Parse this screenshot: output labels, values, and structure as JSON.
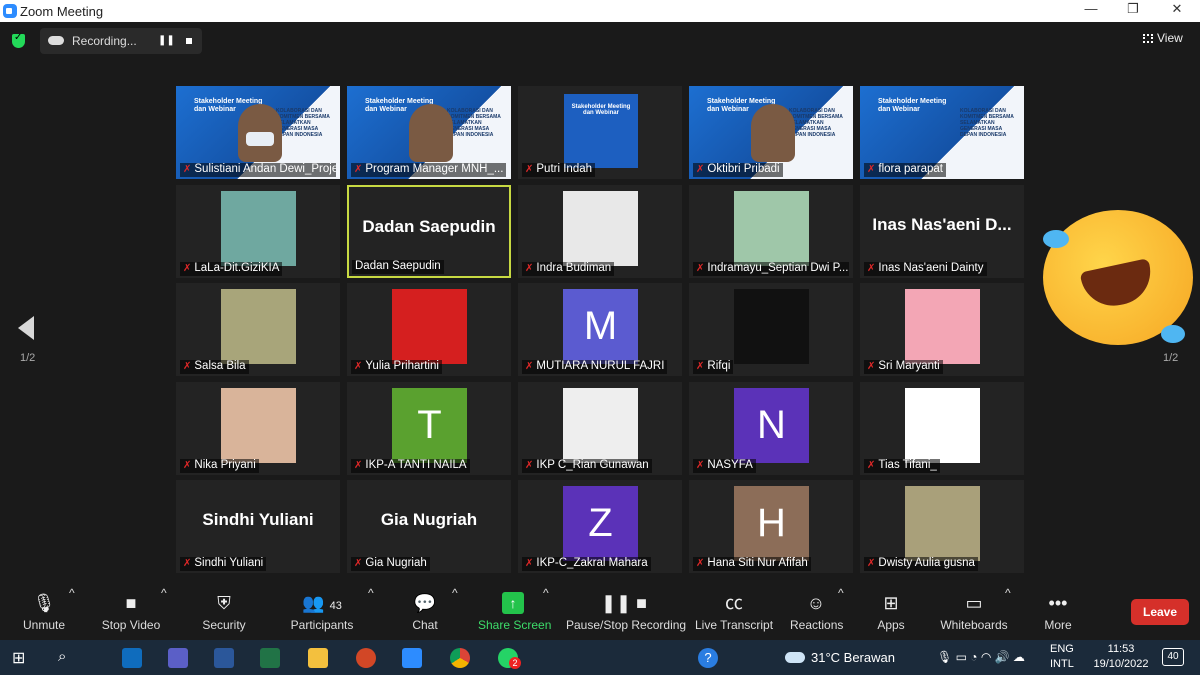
{
  "window": {
    "title": "Zoom Meeting",
    "minimize": "—",
    "maximize": "❐",
    "close": "✕"
  },
  "top": {
    "recording_label": "Recording...",
    "view_label": "View"
  },
  "pager": {
    "left": "1/2",
    "right": "1/2"
  },
  "tiles": [
    {
      "name": "Sulistiani Andan Dewi_Proje...",
      "muted": true,
      "kind": "video-slide"
    },
    {
      "name": "Program Manager MNH_...",
      "muted": true,
      "kind": "video-slide"
    },
    {
      "name": "Putri Indah",
      "muted": true,
      "kind": "slide-small"
    },
    {
      "name": "Oktibri Pribadi",
      "muted": true,
      "kind": "video-slide"
    },
    {
      "name": "flora parapat",
      "muted": true,
      "kind": "slide-only"
    },
    {
      "name": "LaLa-Dit.GiziKIA",
      "muted": true,
      "kind": "photo",
      "color": "#6fa8a0"
    },
    {
      "name": "Dadan Saepudin",
      "muted": false,
      "kind": "bigname",
      "big": "Dadan Saepudin",
      "active": true
    },
    {
      "name": "Indra Budiman",
      "muted": true,
      "kind": "photo",
      "color": "#e8e8e8"
    },
    {
      "name": "Indramayu_Septian Dwi P...",
      "muted": true,
      "kind": "photo",
      "color": "#9fc7a9"
    },
    {
      "name": "Inas Nas'aeni Dainty",
      "muted": true,
      "kind": "bigname",
      "big": "Inas  Nas'aeni  D..."
    },
    {
      "name": "Salsa Bila",
      "muted": true,
      "kind": "photo",
      "color": "#a8a57a"
    },
    {
      "name": "Yulia Prihartini",
      "muted": true,
      "kind": "photo",
      "color": "#d51f1f"
    },
    {
      "name": "MUTIARA NURUL FAJRI",
      "muted": true,
      "kind": "letter",
      "letter": "M",
      "color": "#5b5bd0"
    },
    {
      "name": "Rifqi",
      "muted": true,
      "kind": "photo",
      "color": "#111111"
    },
    {
      "name": "Sri Maryanti",
      "muted": true,
      "kind": "photo",
      "color": "#f3a6b5"
    },
    {
      "name": "Nika Priyani",
      "muted": true,
      "kind": "photo",
      "color": "#d9b49a"
    },
    {
      "name": "IKP-A TANTI NAILA",
      "muted": true,
      "kind": "letter",
      "letter": "T",
      "color": "#5aa12f"
    },
    {
      "name": "IKP C_Rian Gunawan",
      "muted": true,
      "kind": "photo",
      "color": "#eeeeee"
    },
    {
      "name": "NASYFA",
      "muted": true,
      "kind": "letter",
      "letter": "N",
      "color": "#5b32b8"
    },
    {
      "name": "Tias Tifani_",
      "muted": true,
      "kind": "photo",
      "color": "#ffffff"
    },
    {
      "name": "Sindhi Yuliani",
      "muted": true,
      "kind": "bigname",
      "big": "Sindhi Yuliani"
    },
    {
      "name": "Gia Nugriah",
      "muted": true,
      "kind": "bigname",
      "big": "Gia Nugriah"
    },
    {
      "name": "IKP-C_Zakral Mahara",
      "muted": true,
      "kind": "letter",
      "letter": "Z",
      "color": "#5b32b8"
    },
    {
      "name": "Hana Siti Nur Afifah",
      "muted": true,
      "kind": "letter",
      "letter": "H",
      "color": "#8c6d58"
    },
    {
      "name": "Dwisty Aulia gusna",
      "muted": true,
      "kind": "photo",
      "color": "#a9a07a"
    }
  ],
  "slide": {
    "title": "Stakeholder Meeting dan Webinar",
    "subtitle": "KOLABORASI DAN KOMITMEN BERSAMA SELAMATKAN GENERASI MASA DEPAN INDONESIA"
  },
  "toolbar": {
    "unmute": "Unmute",
    "stop_video": "Stop Video",
    "security": "Security",
    "participants": "Participants",
    "participants_count": "43",
    "chat": "Chat",
    "share_screen": "Share Screen",
    "pause_recording": "Pause/Stop Recording",
    "live_transcript": "Live Transcript",
    "reactions": "Reactions",
    "apps": "Apps",
    "whiteboards": "Whiteboards",
    "more": "More",
    "leave": "Leave"
  },
  "taskbar": {
    "weather": "31°C  Berawan",
    "lang1": "ENG",
    "lang2": "INTL",
    "time": "11:53",
    "date": "19/10/2022",
    "notifications": "40",
    "whatsapp_badge": "2"
  }
}
